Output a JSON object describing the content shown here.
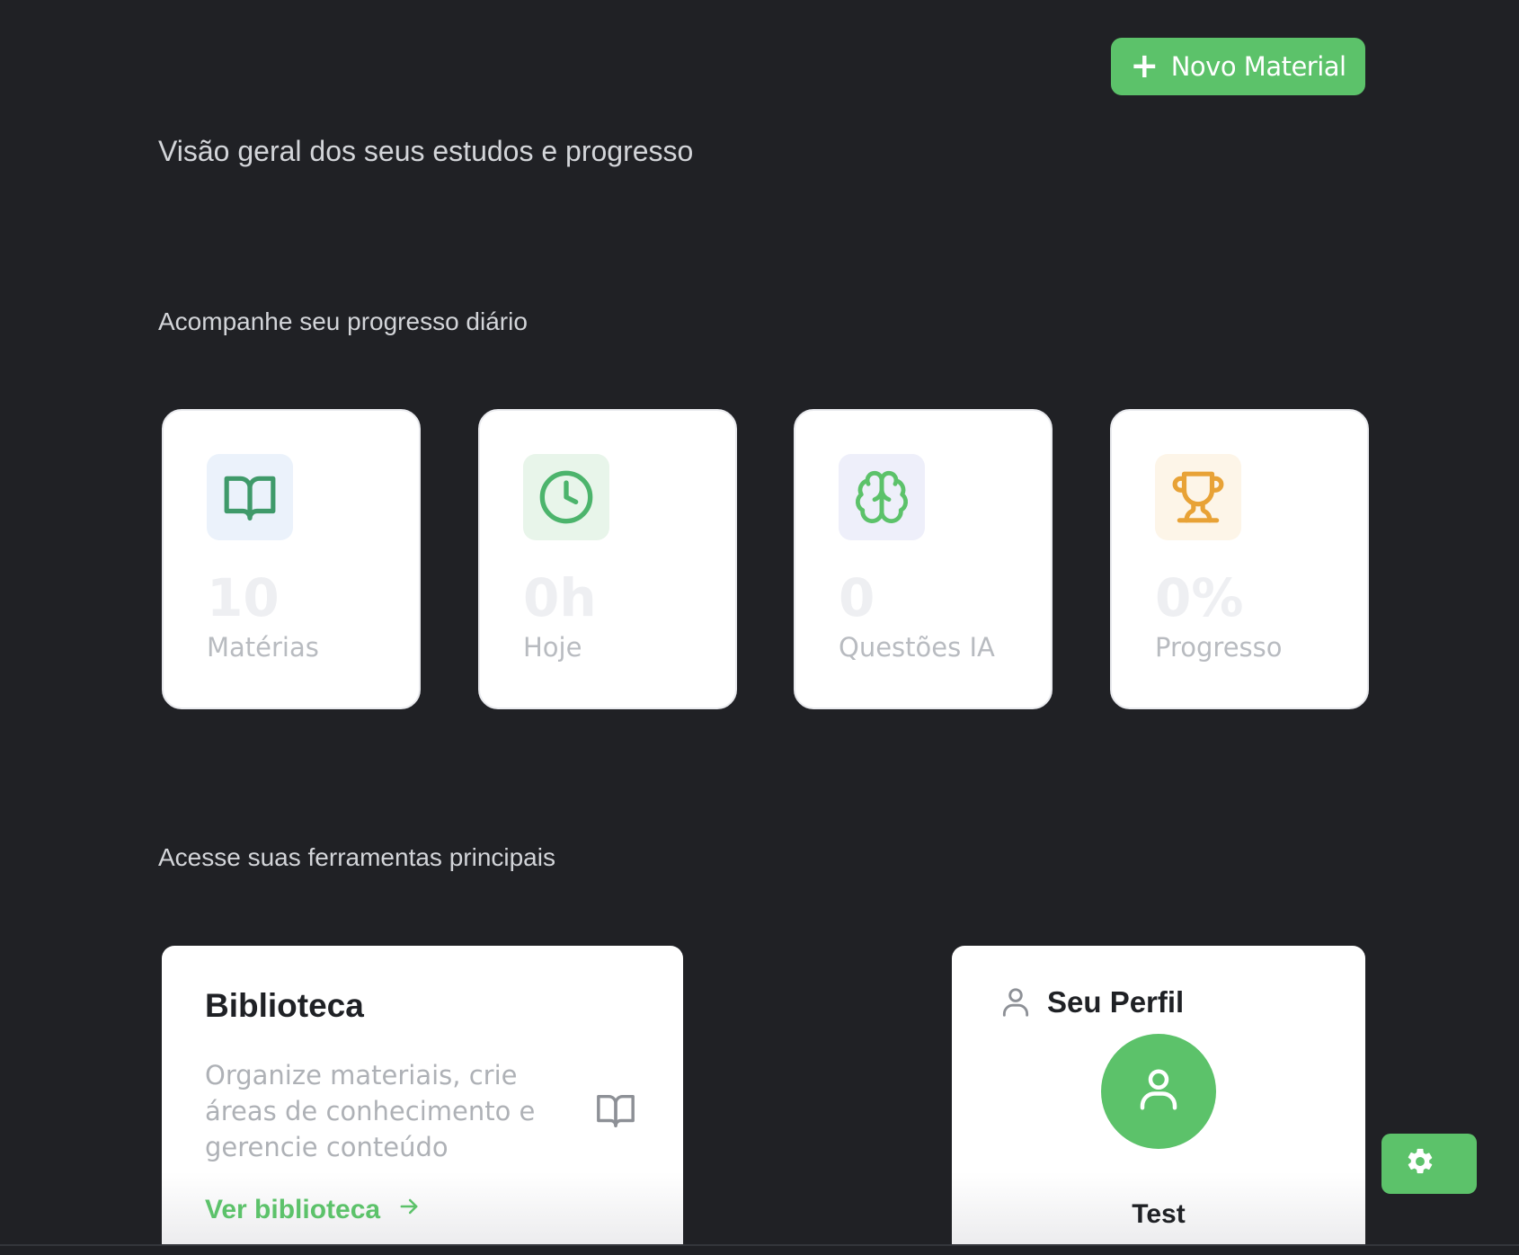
{
  "header": {
    "new_material_label": "Novo Material",
    "subtitle": "Visão geral dos seus estudos e progresso"
  },
  "progress_section": {
    "title": "Acompanhe seu progresso diário",
    "stats": [
      {
        "value": "10",
        "label": "Matérias",
        "icon": "book-open-icon",
        "icon_color": "#3f9a6a",
        "icon_bg": "#ebf2fb"
      },
      {
        "value": "0h",
        "label": "Hoje",
        "icon": "clock-icon",
        "icon_color": "#4cb46c",
        "icon_bg": "#e8f5ea"
      },
      {
        "value": "0",
        "label": "Questões IA",
        "icon": "brain-icon",
        "icon_color": "#5cc26a",
        "icon_bg": "#eeeffa"
      },
      {
        "value": "0%",
        "label": "Progresso",
        "icon": "trophy-icon",
        "icon_color": "#e8a236",
        "icon_bg": "#fdf5e8"
      }
    ]
  },
  "tools_section": {
    "title": "Acesse suas ferramentas principais",
    "library": {
      "title": "Biblioteca",
      "description": "Organize materiais, crie áreas de conhecimento e gerencie conteúdo",
      "link_label": "Ver biblioteca"
    },
    "profile": {
      "title": "Seu Perfil",
      "name": "Test"
    }
  },
  "colors": {
    "accent": "#5cc26a",
    "background": "#202125"
  }
}
